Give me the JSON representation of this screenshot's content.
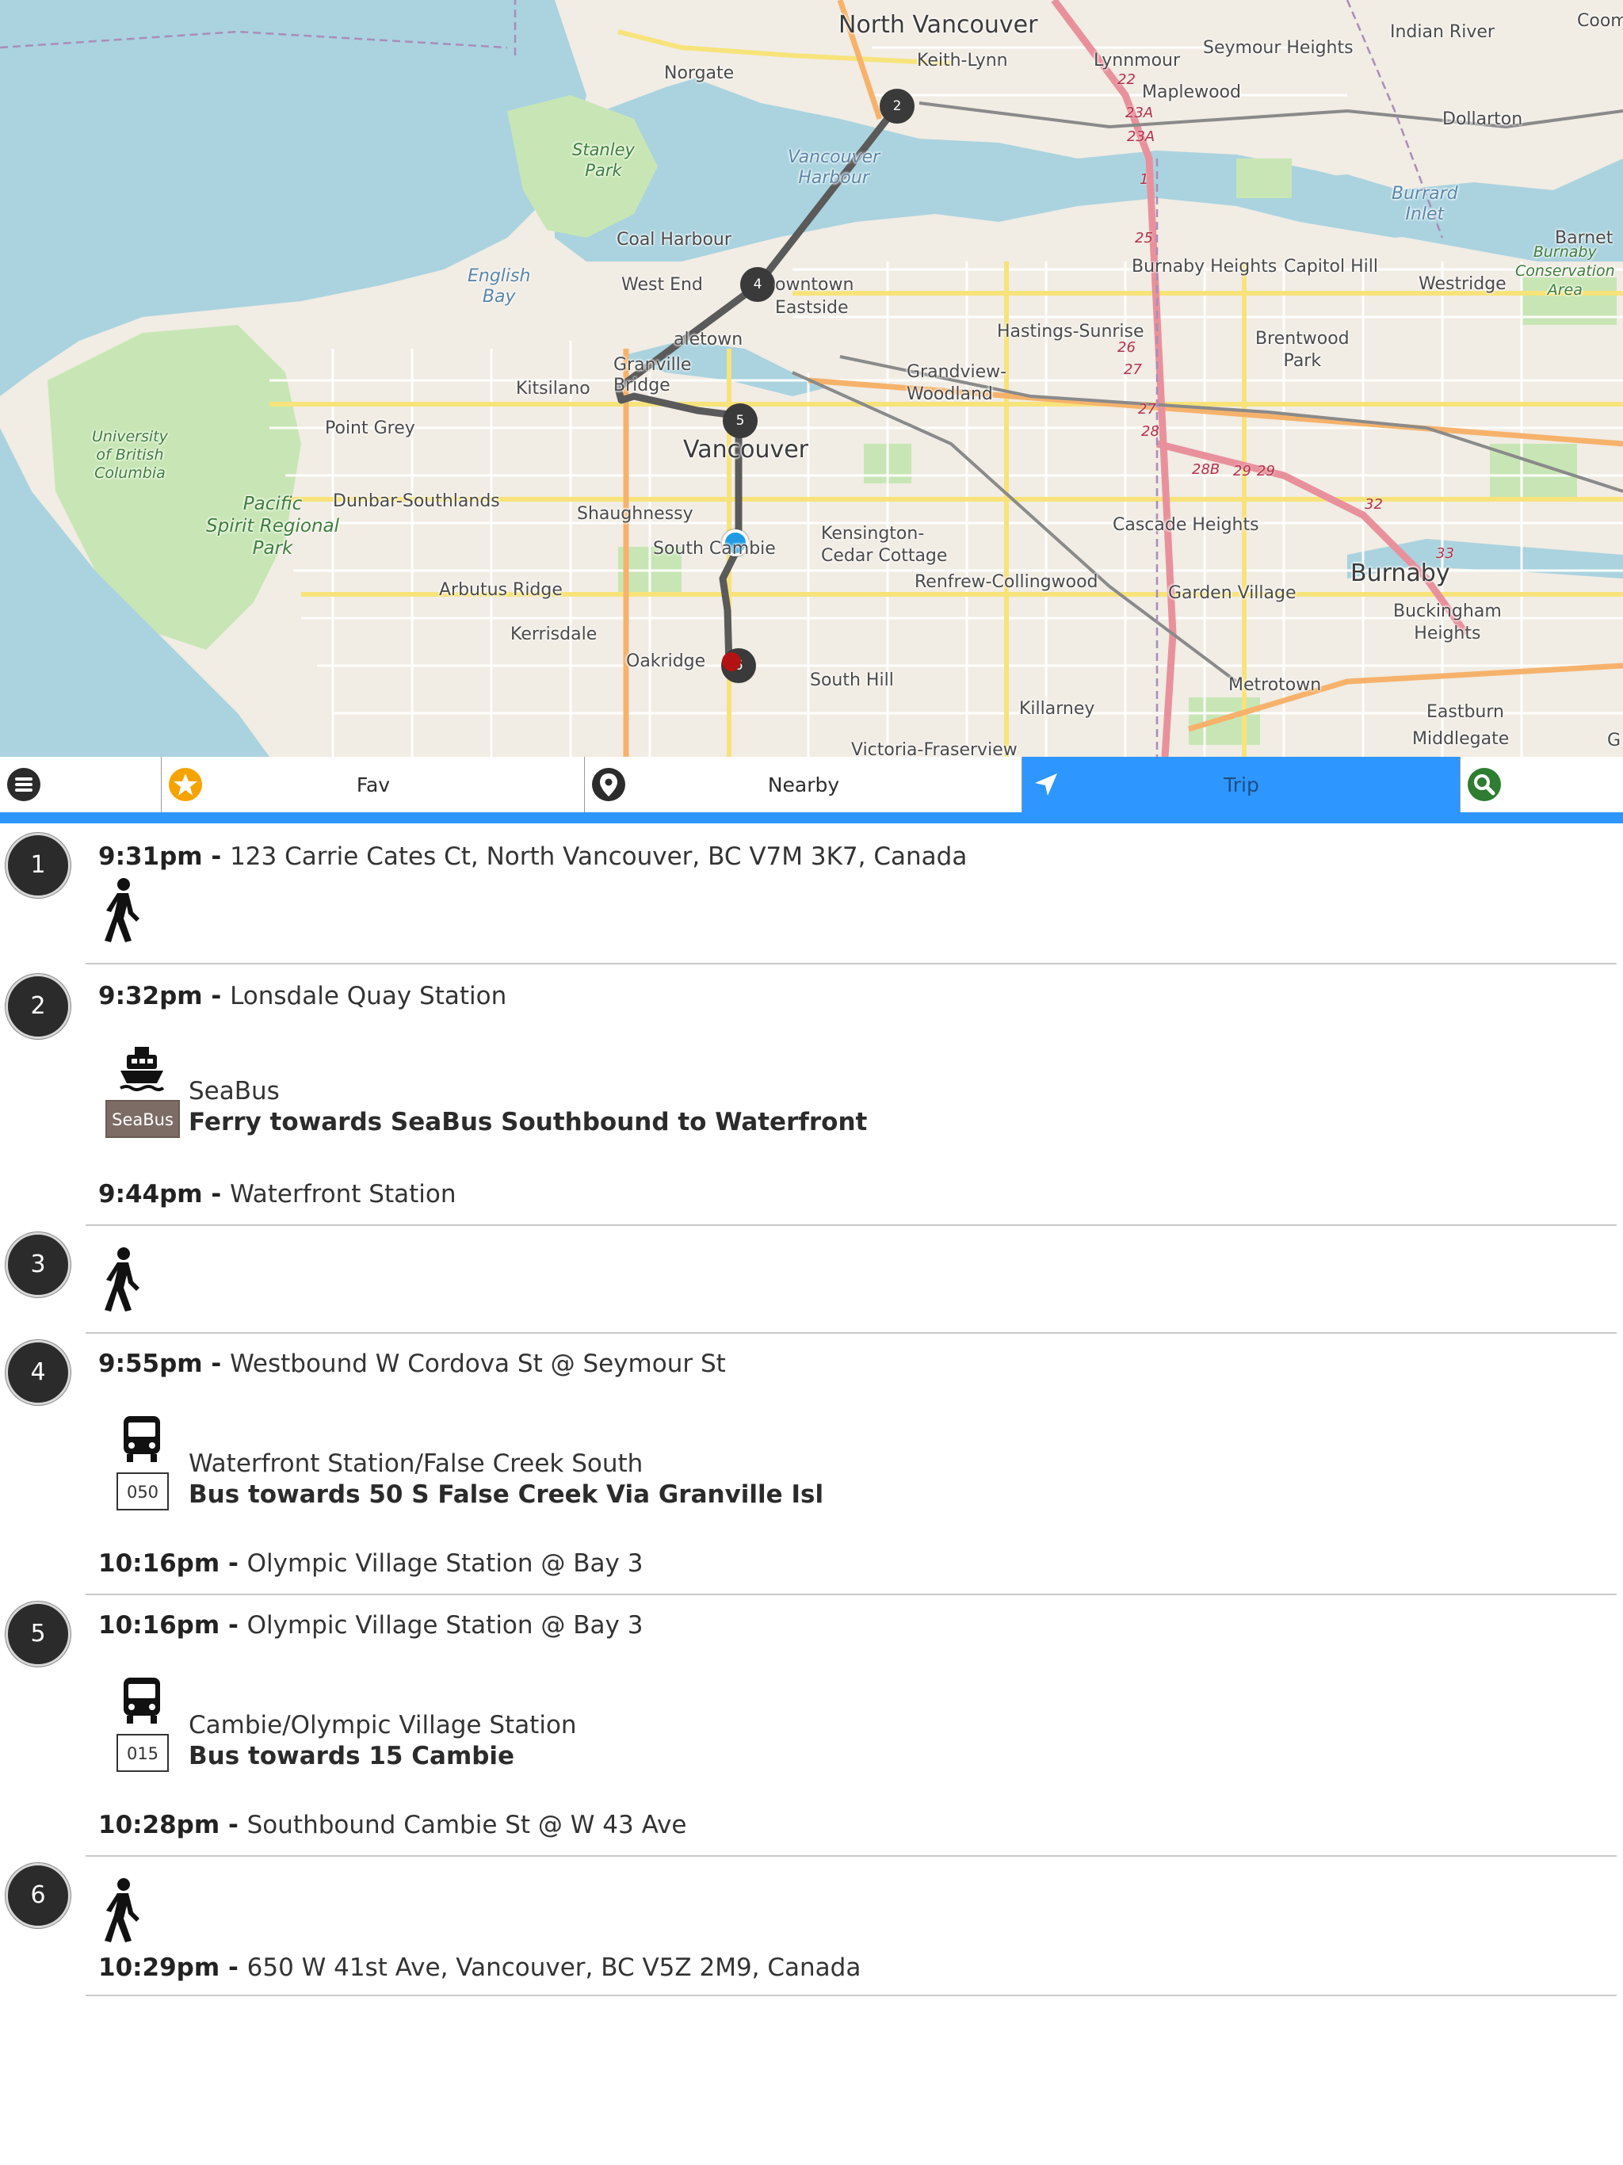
{
  "map": {
    "labels": {
      "north_vancouver": "North Vancouver",
      "keith_lynn": "Keith-Lynn",
      "lynnmour": "Lynnmour",
      "maplewood": "Maplewood",
      "seymour_heights": "Seymour Heights",
      "indian_river": "Indian River",
      "dollarton": "Dollarton",
      "coombe": "Coom",
      "norgate": "Norgate",
      "stanley_park": "Stanley\nPark",
      "vancouver_harbour": "Vancouver\nHarbour",
      "burrard_inlet": "Burrard\nInlet",
      "barnet": "Barnet",
      "burnaby_conservation": "Burnaby\nConservation\nArea",
      "coal_harbour": "Coal Harbour",
      "west_end": "West End",
      "downtown": "owntown",
      "eastside": "Eastside",
      "english_bay": "English\nBay",
      "yaletown": "aletown",
      "granville": "Granville\nBridge",
      "kitsilano": "Kitsilano",
      "grandview": "Grandview-\nWoodland",
      "hastings_sunrise": "Hastings-Sunrise",
      "burnaby_heights": "Burnaby Heights",
      "capitol_hill": "Capitol Hill",
      "westridge": "Westridge",
      "brentwood_park": "Brentwood\nPark",
      "ubc": "University\nof British\nColumbia",
      "point_grey": "Point Grey",
      "vancouver": "Vancouver",
      "pacific_spirit": "Pacific\nSpirit Regional\nPark",
      "dunbar": "Dunbar-Southlands",
      "shaughnessy": "Shaughnessy",
      "south_cambie": "South Cambie",
      "kensington": "Kensington-\nCedar Cottage",
      "cascade_heights": "Cascade Heights",
      "burnaby": "Burnaby",
      "arbutus_ridge": "Arbutus Ridge",
      "renfrew": "Renfrew-Collingwood",
      "garden_village": "Garden Village",
      "buckingham": "Buckingham\nHeights",
      "kerrisdale": "Kerrisdale",
      "oakridge": "Oakridge",
      "south_hill": "South Hill",
      "metrotown": "Metrotown",
      "killarney": "Killarney",
      "eastburn": "Eastburn",
      "middlegate": "Middlegate",
      "victoria_fraserview": "Victoria-Fraserview",
      "g_edge": "G"
    },
    "road_shields": [
      "22",
      "23A",
      "23A",
      "1",
      "25",
      "26",
      "27",
      "27",
      "28",
      "28B",
      "29",
      "29",
      "32",
      "33"
    ],
    "markers": [
      {
        "label": "2"
      },
      {
        "label": "4"
      },
      {
        "label": "5"
      },
      {
        "label": "6"
      }
    ]
  },
  "tabs": {
    "menu_icon": "menu-icon",
    "fav_label": "Fav",
    "nearby_label": "Nearby",
    "trip_label": "Trip",
    "search_icon": "search-icon",
    "active": "Trip",
    "accent_color": "#2d97ff"
  },
  "trip": {
    "steps": [
      {
        "number": "1",
        "lines": [
          {
            "time": "9:31pm",
            "place": "123 Carrie Cates Ct, North Vancouver, BC V7M 3K7, Canada"
          }
        ],
        "mode": "walk"
      },
      {
        "number": "2",
        "lines": [
          {
            "time": "9:32pm",
            "place": "Lonsdale Quay Station"
          }
        ],
        "mode": "ferry",
        "badge": "SeaBus",
        "route_name": "SeaBus",
        "route_direction": "Ferry towards SeaBus Southbound to Waterfront",
        "end": {
          "time": "9:44pm",
          "place": "Waterfront Station"
        }
      },
      {
        "number": "3",
        "mode": "walk"
      },
      {
        "number": "4",
        "lines": [
          {
            "time": "9:55pm",
            "place": "Westbound W Cordova St @ Seymour St"
          }
        ],
        "mode": "bus",
        "badge": "050",
        "route_name": "Waterfront Station/False Creek South",
        "route_direction": "Bus towards 50 S False Creek Via Granville Isl",
        "end": {
          "time": "10:16pm",
          "place": "Olympic Village Station @ Bay 3"
        }
      },
      {
        "number": "5",
        "lines": [
          {
            "time": "10:16pm",
            "place": "Olympic Village Station @ Bay 3"
          }
        ],
        "mode": "bus",
        "badge": "015",
        "route_name": "Cambie/Olympic Village Station",
        "route_direction": "Bus towards 15 Cambie",
        "end": {
          "time": "10:28pm",
          "place": "Southbound Cambie St @ W 43 Ave"
        }
      },
      {
        "number": "6",
        "mode": "walk",
        "end": {
          "time": "10:29pm",
          "place": "650 W 41st Ave, Vancouver, BC V5Z 2M9, Canada"
        }
      }
    ]
  },
  "separator": " - "
}
